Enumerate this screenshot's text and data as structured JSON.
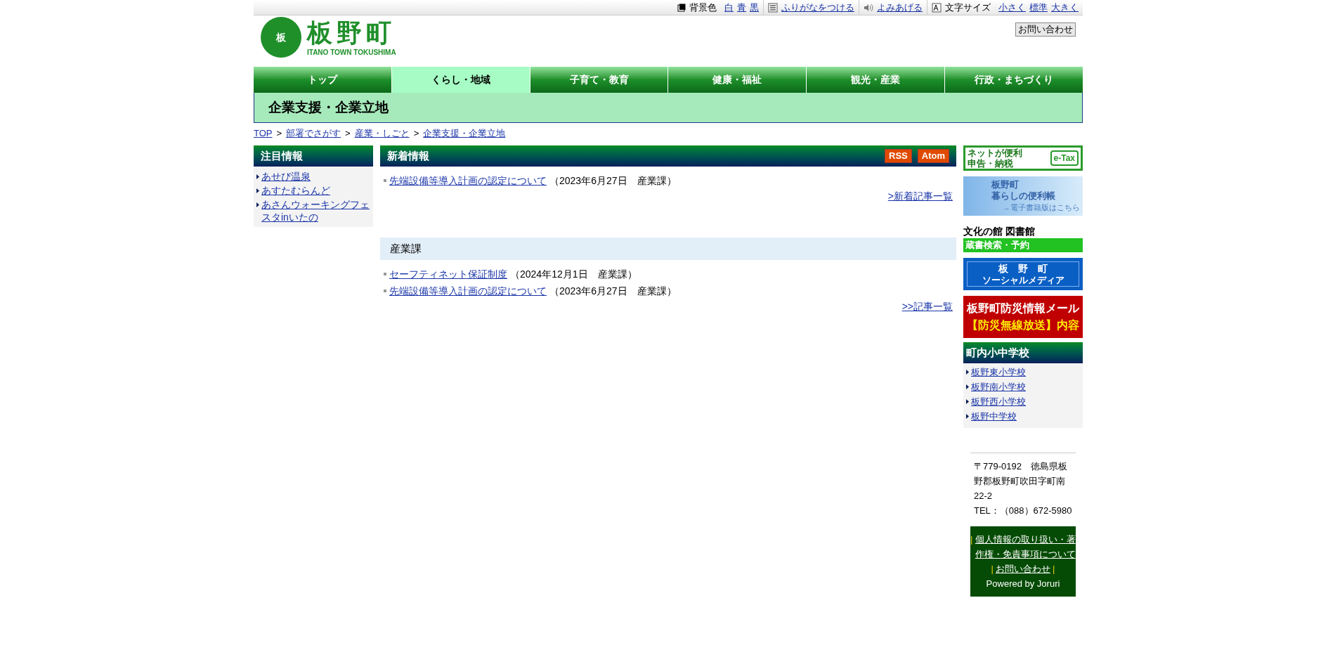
{
  "toolbar": {
    "groups": [
      {
        "kind": "background",
        "label": "背景色",
        "links": [
          "白",
          "青",
          "黒"
        ]
      },
      {
        "kind": "furigana",
        "links": [
          "ふりがなをつける"
        ]
      },
      {
        "kind": "speech",
        "links": [
          "よみあげる"
        ]
      },
      {
        "kind": "fontsize",
        "label": "文字サイズ",
        "links": [
          "小さく",
          "標準",
          "大きく"
        ]
      }
    ]
  },
  "logo": {
    "mark": "板",
    "name": "板野町",
    "subtitle": "ITANO TOWN TOKUSHIMA"
  },
  "contact_button": "お問い合わせ",
  "nav": [
    {
      "label": "トップ",
      "selected": false
    },
    {
      "label": "くらし・地域",
      "selected": true
    },
    {
      "label": "子育て・教育",
      "selected": false
    },
    {
      "label": "健康・福祉",
      "selected": false
    },
    {
      "label": "観光・産業",
      "selected": false
    },
    {
      "label": "行政・まちづくり",
      "selected": false
    }
  ],
  "page_title": "企業支援・企業立地",
  "breadcrumb": {
    "separator": ">",
    "items": [
      "TOP",
      "部署でさがす",
      "産業・しごと",
      "企業支援・企業立地"
    ]
  },
  "featured": {
    "title": "注目情報",
    "items": [
      "あせび温泉",
      "あすたむらんど",
      "あさんウォーキングフェスタinいたの"
    ]
  },
  "news": {
    "title": "新着情報",
    "feeds": [
      "RSS",
      "Atom"
    ],
    "items": [
      {
        "link": "先端設備等導入計画の認定について",
        "meta": "（2023年6月27日　産業課）"
      }
    ],
    "more": ">新着記事一覧"
  },
  "section": {
    "title": "産業課",
    "items": [
      {
        "link": "セーフティネット保証制度",
        "meta": "（2024年12月1日　産業課）"
      },
      {
        "link": "先端設備等導入計画の認定について",
        "meta": "（2023年6月27日　産業課）"
      }
    ],
    "more": ">>記事一覧"
  },
  "banners": [
    {
      "kind": "etax",
      "lines": [
        "ネットが便利",
        "申告・納税"
      ],
      "badge": "e-Tax"
    },
    {
      "kind": "guide",
      "lines": [
        "板野町",
        "暮らしの便利帳",
        "→電子書籍版はこちら"
      ]
    },
    {
      "kind": "library",
      "lines": [
        "文化の館 図書館",
        "蔵書検索・予約"
      ]
    },
    {
      "kind": "social",
      "lines": [
        "板　野　町",
        "ソーシャルメディア"
      ]
    },
    {
      "kind": "disaster",
      "lines": [
        "板野町防災情報メール",
        "【防災無線放送】内容"
      ]
    }
  ],
  "schools": {
    "title": "町内小中学校",
    "items": [
      "板野東小学校",
      "板野南小学校",
      "板野西小学校",
      "板野中学校"
    ]
  },
  "address": [
    "〒779-0192　徳島県板野郡板野町吹田字町南22-2",
    "TEL：（088）672-5980"
  ],
  "footer": {
    "separator": "|",
    "links": [
      "個人情報の取り扱い・著作権・免責事項について",
      "お問い合わせ"
    ],
    "powered": "Powered by Joruri"
  }
}
